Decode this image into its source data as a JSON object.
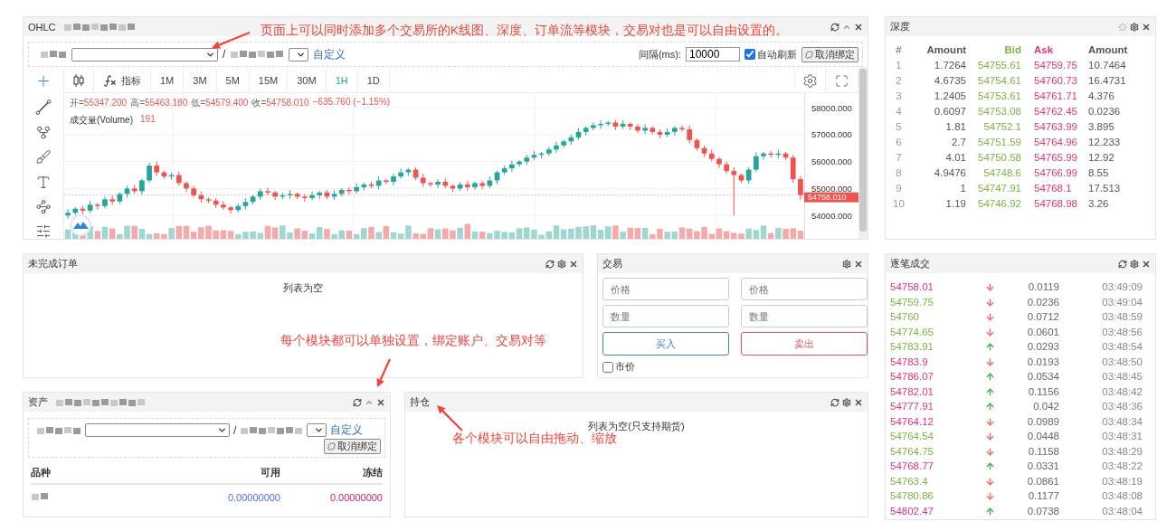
{
  "annotations": [
    {
      "text": "页面上可以同时添加多个交易所的K线图、深度、订单流等模块，交易对也是可以自由设置的。"
    },
    {
      "text": "每个模块都可以单独设置，绑定账户、交易对等"
    },
    {
      "text": "各个模块可以自由拖动、缩放"
    }
  ],
  "chart_panel": {
    "title": "OHLC",
    "separator": "/",
    "custom_link": "自定义",
    "interval_label": "间隔(ms):",
    "interval_value": "10000",
    "auto_refresh": {
      "label": "自动刷新",
      "checked": true
    },
    "unbind_button": "取消绑定",
    "indicator_button": "指标",
    "periods": [
      {
        "label": "1M",
        "selected": false
      },
      {
        "label": "3M",
        "selected": false
      },
      {
        "label": "5M",
        "selected": false
      },
      {
        "label": "15M",
        "selected": false
      },
      {
        "label": "30M",
        "selected": false
      },
      {
        "label": "1H",
        "selected": true
      },
      {
        "label": "1D",
        "selected": false
      }
    ],
    "legend": {
      "items": [
        {
          "label": "开=",
          "value": "55347.200"
        },
        {
          "label": "高=",
          "value": "55463.180"
        },
        {
          "label": "低=",
          "value": "54579.400"
        },
        {
          "label": "收=",
          "value": "54758.010"
        }
      ],
      "change": "−635.760 (−1.15%)",
      "volume_label": "成交量(Volume)",
      "volume_value": "191"
    },
    "last_price": "54758.010",
    "chart_data": {
      "type": "candlestick",
      "grid": true,
      "ylim": [
        53100,
        58540
      ],
      "yticks": [
        {
          "value": 58000,
          "label": "58000.000"
        },
        {
          "value": 57000,
          "label": "57000.000"
        },
        {
          "value": 56000,
          "label": "56000.000"
        },
        {
          "value": 55000,
          "label": "55000.000"
        },
        {
          "value": 54000,
          "label": "54000.000"
        }
      ],
      "categories": [
        null,
        null,
        null,
        null,
        null,
        null,
        null,
        null,
        null,
        null,
        null,
        null,
        null,
        null,
        null,
        null,
        null,
        null,
        null,
        null,
        null,
        null,
        null,
        null,
        null,
        null,
        null,
        null,
        null,
        null,
        null,
        null,
        null,
        null,
        null,
        null,
        null,
        null,
        null,
        null,
        null,
        null,
        null,
        null,
        null,
        null,
        null,
        null,
        null,
        null,
        null,
        null,
        null,
        null,
        null,
        null,
        null,
        null,
        null,
        null,
        null,
        null,
        null,
        null,
        null,
        null,
        null,
        null,
        null,
        null,
        null,
        null,
        null,
        null,
        null,
        null,
        null,
        null,
        null,
        null,
        null,
        null,
        null,
        null,
        null,
        null,
        null,
        null,
        null,
        null,
        null,
        null,
        null,
        null,
        null,
        null,
        null,
        null,
        null,
        null
      ],
      "ohlc": [
        [
          54000,
          54240,
          53870,
          54100
        ],
        [
          54100,
          54310,
          54010,
          54250
        ],
        [
          54250,
          54350,
          54050,
          54180
        ],
        [
          54180,
          54540,
          54090,
          54400
        ],
        [
          54400,
          54460,
          54220,
          54350
        ],
        [
          54350,
          54700,
          54260,
          54600
        ],
        [
          54600,
          54740,
          54390,
          54520
        ],
        [
          54520,
          54860,
          54430,
          54800
        ],
        [
          54800,
          55100,
          54670,
          55000
        ],
        [
          55000,
          55140,
          54810,
          54900
        ],
        [
          54900,
          55360,
          54770,
          55300
        ],
        [
          55300,
          55950,
          55210,
          55850
        ],
        [
          55850,
          55990,
          55470,
          55600
        ],
        [
          55600,
          55660,
          55360,
          55450
        ],
        [
          55450,
          55600,
          55320,
          55500
        ],
        [
          55500,
          55640,
          55110,
          55200
        ],
        [
          55200,
          55260,
          54870,
          55000
        ],
        [
          55000,
          55100,
          54660,
          54750
        ],
        [
          54750,
          54890,
          54470,
          54600
        ],
        [
          54600,
          54660,
          54460,
          54550
        ],
        [
          54550,
          54650,
          54270,
          54400
        ],
        [
          54400,
          54540,
          54210,
          54300
        ],
        [
          54300,
          54360,
          54070,
          54200
        ],
        [
          54200,
          54450,
          54110,
          54350
        ],
        [
          54350,
          54640,
          54220,
          54500
        ],
        [
          54500,
          54760,
          54410,
          54700
        ],
        [
          54700,
          55000,
          54570,
          54900
        ],
        [
          54900,
          55040,
          54760,
          54850
        ],
        [
          54850,
          54910,
          54570,
          54700
        ],
        [
          54700,
          54850,
          54610,
          54750
        ],
        [
          54750,
          54940,
          54620,
          54800
        ],
        [
          54800,
          54860,
          54610,
          54700
        ],
        [
          54700,
          54800,
          54520,
          54650
        ],
        [
          54650,
          54890,
          54560,
          54750
        ],
        [
          54750,
          54910,
          54620,
          54850
        ],
        [
          54850,
          54950,
          54610,
          54700
        ],
        [
          54700,
          54940,
          54570,
          54800
        ],
        [
          54800,
          55010,
          54710,
          54950
        ],
        [
          54950,
          55050,
          54770,
          54900
        ],
        [
          54900,
          55190,
          54810,
          55050
        ],
        [
          55050,
          55210,
          54920,
          55150
        ],
        [
          55150,
          55250,
          55010,
          55100
        ],
        [
          55100,
          55440,
          54970,
          55300
        ],
        [
          55300,
          55360,
          55160,
          55250
        ],
        [
          55250,
          55550,
          55120,
          55450
        ],
        [
          55450,
          55740,
          55360,
          55600
        ],
        [
          55600,
          55760,
          55470,
          55700
        ],
        [
          55700,
          55800,
          55310,
          55400
        ],
        [
          55400,
          55540,
          55070,
          55200
        ],
        [
          55200,
          55260,
          55060,
          55150
        ],
        [
          55150,
          55350,
          55020,
          55250
        ],
        [
          55250,
          55390,
          55010,
          55100
        ],
        [
          55100,
          55160,
          54870,
          55000
        ],
        [
          55000,
          55250,
          54910,
          55150
        ],
        [
          55150,
          55290,
          54920,
          55050
        ],
        [
          55050,
          55260,
          54960,
          55200
        ],
        [
          55200,
          55300,
          54970,
          55100
        ],
        [
          55100,
          55440,
          55010,
          55300
        ],
        [
          55300,
          55660,
          55170,
          55600
        ],
        [
          55600,
          55850,
          55510,
          55750
        ],
        [
          55750,
          56040,
          55620,
          55900
        ],
        [
          55900,
          56060,
          55810,
          56000
        ],
        [
          56000,
          56250,
          55870,
          56150
        ],
        [
          56150,
          56390,
          56060,
          56250
        ],
        [
          56250,
          56360,
          56120,
          56300
        ],
        [
          56300,
          56550,
          56210,
          56450
        ],
        [
          56450,
          56740,
          56320,
          56600
        ],
        [
          56600,
          56810,
          56510,
          56750
        ],
        [
          56750,
          57000,
          56620,
          56900
        ],
        [
          56900,
          57240,
          56810,
          57100
        ],
        [
          57100,
          57310,
          56970,
          57250
        ],
        [
          57250,
          57450,
          57160,
          57350
        ],
        [
          57350,
          57540,
          57220,
          57400
        ],
        [
          57400,
          57510,
          57310,
          57450
        ],
        [
          57450,
          57550,
          57170,
          57300
        ],
        [
          57300,
          57540,
          57210,
          57400
        ],
        [
          57400,
          57460,
          57170,
          57300
        ],
        [
          57300,
          57400,
          57060,
          57150
        ],
        [
          57150,
          57390,
          57020,
          57250
        ],
        [
          57250,
          57310,
          57010,
          57100
        ],
        [
          57100,
          57200,
          56870,
          57000
        ],
        [
          57000,
          57240,
          56910,
          57100
        ],
        [
          57100,
          57310,
          56970,
          57250
        ],
        [
          57250,
          57350,
          57110,
          57200
        ],
        [
          57200,
          57340,
          56670,
          56800
        ],
        [
          56800,
          56860,
          56410,
          56500
        ],
        [
          56500,
          56600,
          56170,
          56300
        ],
        [
          56300,
          56440,
          56010,
          56100
        ],
        [
          56100,
          56160,
          55770,
          55900
        ],
        [
          55900,
          56000,
          55560,
          55650
        ],
        [
          55650,
          55790,
          54000,
          55500
        ],
        [
          55500,
          55560,
          55210,
          55300
        ],
        [
          55300,
          55800,
          55170,
          55700
        ],
        [
          55700,
          56340,
          55610,
          56200
        ],
        [
          56200,
          56360,
          56070,
          56300
        ],
        [
          56300,
          56400,
          56160,
          56250
        ],
        [
          56250,
          56440,
          56120,
          56300
        ],
        [
          56300,
          56360,
          56060,
          56150
        ],
        [
          56150,
          56250,
          55217.2,
          55347.2
        ],
        [
          55347.2,
          55463.18,
          54579.4,
          54758.01
        ]
      ]
    }
  },
  "depth": {
    "title": "深度",
    "columns": [
      "#",
      "Amount",
      "Bid",
      "Ask",
      "Amount"
    ],
    "rows": [
      [
        "1",
        "1.7264",
        "54755.61",
        "54759.75",
        "10.7464"
      ],
      [
        "2",
        "4.6735",
        "54754.61",
        "54760.73",
        "16.4731"
      ],
      [
        "3",
        "1.2405",
        "54753.61",
        "54761.71",
        "4.376"
      ],
      [
        "4",
        "0.6097",
        "54753.08",
        "54762.45",
        "0.0236"
      ],
      [
        "5",
        "1.81",
        "54752.1",
        "54763.99",
        "3.895"
      ],
      [
        "6",
        "2.7",
        "54751.59",
        "54764.96",
        "12.233"
      ],
      [
        "7",
        "4.01",
        "54750.58",
        "54765.99",
        "12.92"
      ],
      [
        "8",
        "4.9476",
        "54748.6",
        "54766.99",
        "8.55"
      ],
      [
        "9",
        "1",
        "54747.91",
        "54768.1",
        "17.513"
      ],
      [
        "10",
        "1.19",
        "54746.92",
        "54768.98",
        "3.26"
      ]
    ]
  },
  "open_orders": {
    "title": "未完成订单",
    "empty_text": "列表为空"
  },
  "trade": {
    "title": "交易",
    "fields": [
      {
        "placeholder": "价格"
      },
      {
        "placeholder": "价格"
      },
      {
        "placeholder": "数量"
      },
      {
        "placeholder": "数量"
      }
    ],
    "buy_button": "买入",
    "sell_button": "卖出",
    "market": {
      "label": "市价",
      "checked": false
    }
  },
  "assets": {
    "title": "资产",
    "separator": "/",
    "custom_link": "自定义",
    "unbind_button": "取消绑定",
    "columns": [
      "品种",
      "可用",
      "冻结"
    ],
    "rows": [
      {
        "available": "0.00000000",
        "frozen": "0.00000000"
      }
    ]
  },
  "positions": {
    "title": "持仓",
    "empty_text": "列表为空(只支持期货)"
  },
  "trades": {
    "title": "逐笔成交",
    "rows": [
      {
        "price": "54758.01",
        "color": "#e8317a",
        "kind": "down",
        "amount": "0.0119",
        "time": "03:49:09"
      },
      {
        "price": "54759.75",
        "color": "#7cb342",
        "kind": "down",
        "amount": "0.0236",
        "time": "03:49:04"
      },
      {
        "price": "54760",
        "color": "#7cb342",
        "kind": "down",
        "amount": "0.0712",
        "time": "03:48:59"
      },
      {
        "price": "54774.65",
        "color": "#7cb342",
        "kind": "down",
        "amount": "0.0601",
        "time": "03:48:56"
      },
      {
        "price": "54783.91",
        "color": "#7cb342",
        "kind": "up",
        "amount": "0.0293",
        "time": "03:48:54"
      },
      {
        "price": "54783.9",
        "color": "#e8317a",
        "kind": "down",
        "amount": "0.0193",
        "time": "03:48:50"
      },
      {
        "price": "54786.07",
        "color": "#e8317a",
        "kind": "up",
        "amount": "0.0534",
        "time": "03:48:45"
      },
      {
        "price": "54782.01",
        "color": "#e8317a",
        "kind": "up",
        "amount": "0.1156",
        "time": "03:48:42"
      },
      {
        "price": "54777.91",
        "color": "#e8317a",
        "kind": "up",
        "amount": "0.042",
        "time": "03:48:36"
      },
      {
        "price": "54764.12",
        "color": "#e8317a",
        "kind": "down",
        "amount": "0.0989",
        "time": "03:48:34"
      },
      {
        "price": "54764.54",
        "color": "#7cb342",
        "kind": "down",
        "amount": "0.0448",
        "time": "03:48:31"
      },
      {
        "price": "54764.75",
        "color": "#7cb342",
        "kind": "down",
        "amount": "0.1158",
        "time": "03:48:29"
      },
      {
        "price": "54768.77",
        "color": "#e8317a",
        "kind": "up",
        "amount": "0.0331",
        "time": "03:48:22"
      },
      {
        "price": "54763.4",
        "color": "#7cb342",
        "kind": "down",
        "amount": "0.0861",
        "time": "03:48:19"
      },
      {
        "price": "54780.86",
        "color": "#7cb342",
        "kind": "down",
        "amount": "0.1177",
        "time": "03:48:08"
      },
      {
        "price": "54802.47",
        "color": "#e8317a",
        "kind": "up",
        "amount": "0.0738",
        "time": "03:48:04"
      }
    ]
  }
}
